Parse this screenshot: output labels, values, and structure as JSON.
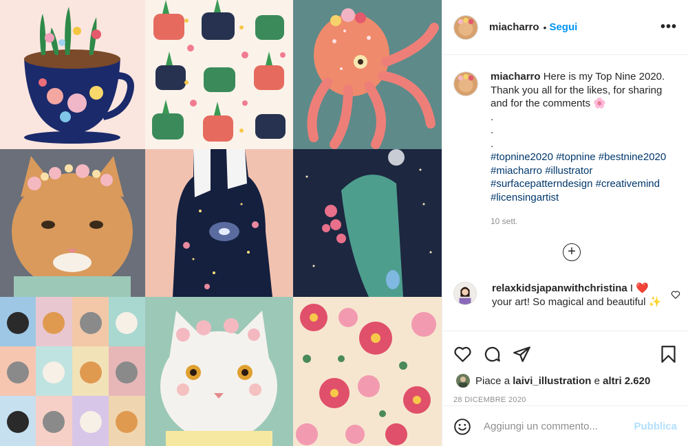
{
  "post": {
    "author": "miacharro",
    "follow_label": "Segui",
    "follow_separator": "•",
    "more_label": "•••"
  },
  "caption": {
    "username": "miacharro",
    "text": " Here is my Top Nine 2020. Thank you all for the likes, for sharing and for the comments 🌸",
    "dots": [
      ".",
      ".",
      "."
    ],
    "hashtags": "#topnine2020 #topnine #bestnine2020 #miacharro #illustrator #surfacepatterndesign #creativemind #licensingartist",
    "time": "10 sett.",
    "load_more_label": "+"
  },
  "comment": {
    "username": "relaxkidsjapanwithchristina",
    "text": " I ❤️ your art! So magical and beautiful ✨"
  },
  "actions": {
    "likes_prefix": "Piace a ",
    "likes_user": "laivi_illustration",
    "likes_and": " e ",
    "likes_others": "altri 2.620",
    "date": "28 DICEMBRE 2020"
  },
  "add_comment": {
    "placeholder": "Aggiungi un commento...",
    "publish_label": "Pubblica"
  },
  "grid": {
    "tiles": [
      "tile-teacup-flowers",
      "tile-teacups-pattern",
      "tile-octopus",
      "tile-cat-flower-crown",
      "tile-galaxy-woman",
      "tile-whale-space",
      "tile-cats-grid",
      "tile-white-cat",
      "tile-floral-pattern"
    ]
  },
  "colors": {
    "link_blue": "#0095f6",
    "hashtag_blue": "#00376b",
    "publish_disabled": "#b2dffc",
    "meta_gray": "#8e8e8e"
  }
}
